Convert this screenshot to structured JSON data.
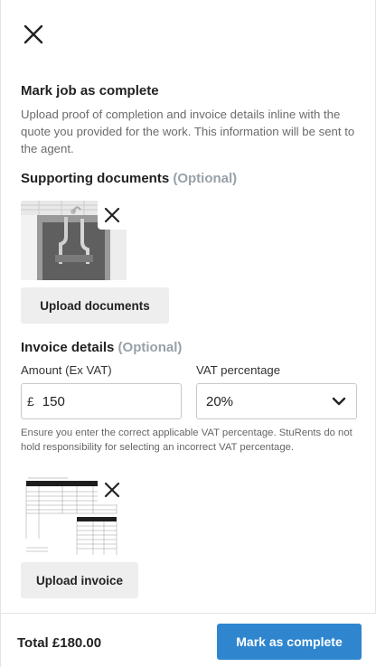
{
  "header": {
    "close_icon": "close-icon"
  },
  "intro": {
    "title": "Mark job as complete",
    "description": "Upload proof of completion and invoice details inline with the quote you provided for the work. This information will be sent to the agent."
  },
  "supporting_documents": {
    "title": "Supporting documents",
    "optional": "(Optional)",
    "upload_label": "Upload documents"
  },
  "invoice": {
    "title": "Invoice details",
    "optional": "(Optional)",
    "amount_label": "Amount (Ex VAT)",
    "currency_symbol": "£",
    "amount_value": "150",
    "vat_label": "VAT percentage",
    "vat_value": "20%",
    "note": "Ensure you enter the correct applicable VAT percentage. StuRents do not hold responsibility for selecting an incorrect VAT percentage.",
    "upload_label": "Upload invoice"
  },
  "footer": {
    "total": "Total £180.00",
    "primary_label": "Mark as complete"
  },
  "colors": {
    "primary": "#2f86cf",
    "muted_optional": "#98a1a8",
    "button_grey": "#eeeeee"
  }
}
